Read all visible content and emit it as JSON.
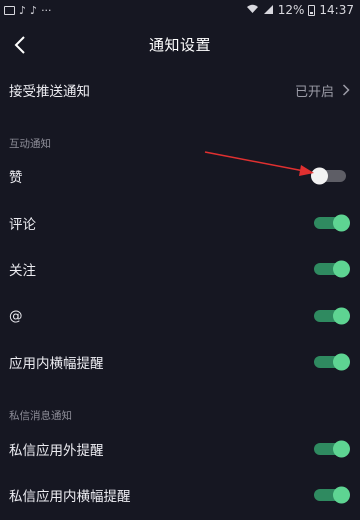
{
  "status_bar": {
    "left_icons": [
      "image-icon",
      "tiktok-icon",
      "tiktok-icon",
      "more-dots-icon"
    ],
    "wifi_signal": "wifi-icon",
    "signal": "signal-icon",
    "battery_percent": "12%",
    "time": "14:37"
  },
  "header": {
    "title": "通知设置",
    "back_icon": "chevron-left-icon"
  },
  "push": {
    "label": "接受推送通知",
    "value": "已开启",
    "chevron": "chevron-right-icon"
  },
  "sections": {
    "interaction": "互动通知",
    "dm": "私信消息通知"
  },
  "interaction_items": [
    {
      "label": "赞",
      "enabled": false
    },
    {
      "label": "评论",
      "enabled": true
    },
    {
      "label": "关注",
      "enabled": true
    },
    {
      "label": "@",
      "enabled": true
    },
    {
      "label": "应用内横幅提醒",
      "enabled": true
    }
  ],
  "dm_items": [
    {
      "label": "私信应用外提醒",
      "enabled": true
    },
    {
      "label": "私信应用内横幅提醒",
      "enabled": true
    }
  ],
  "colors": {
    "background": "#161722",
    "toggle_on_track": "#2f8a60",
    "toggle_on_knob": "#5ed492",
    "toggle_off_track": "#5e5e66",
    "toggle_off_knob": "#f2f2f2",
    "annotation_arrow": "#e03030"
  },
  "annotation": {
    "type": "red-arrow",
    "points_to": "toggle-like"
  }
}
